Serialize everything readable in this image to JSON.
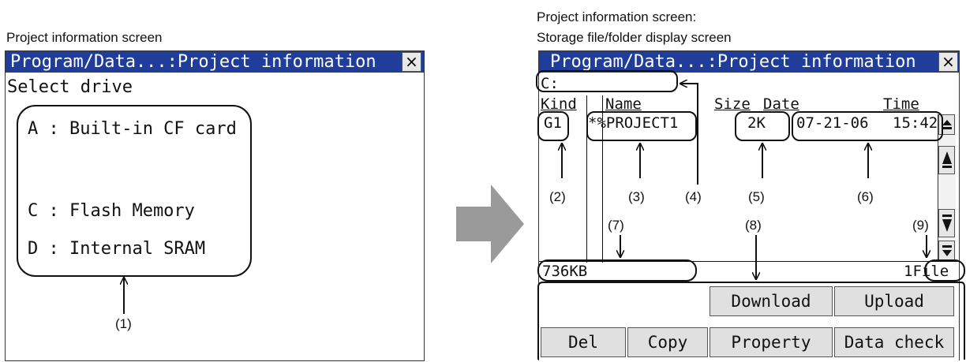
{
  "left_caption": "Project information screen",
  "right_caption_line1": "Project information screen:",
  "right_caption_line2": "Storage file/folder display screen",
  "left_screen": {
    "title": "Program/Data...:Project information",
    "close_glyph": "×",
    "prompt": "Select drive",
    "drives": [
      {
        "label": "A : Built-in CF card"
      },
      {
        "label": "C : Flash Memory"
      },
      {
        "label": "D : Internal SRAM"
      }
    ],
    "callout": "(1)"
  },
  "right_screen": {
    "title": "Program/Data...:Project information",
    "close_glyph": "×",
    "path": "C:",
    "headers": {
      "kind": "Kind",
      "name": "Name",
      "size": "Size",
      "date": "Date",
      "time": "Time"
    },
    "row": {
      "kind": "G1",
      "name": "*%PROJECT1",
      "size": "2K",
      "date": "07-21-06",
      "time": "15:42"
    },
    "free_space": "736KB",
    "file_count": "1File",
    "callouts": [
      "(2)",
      "(3)",
      "(4)",
      "(5)",
      "(6)",
      "(7)",
      "(8)",
      "(9)"
    ],
    "buttons": {
      "download": "Download",
      "upload": "Upload",
      "del": "Del",
      "copy": "Copy",
      "property": "Property",
      "data_check": "Data check"
    },
    "scroll_icons": [
      "scroll-top-icon",
      "scroll-up-icon",
      "scroll-down-icon",
      "scroll-bottom-icon"
    ]
  },
  "transition_arrow_color": "#9a9a9a",
  "titlebar_color": "#1f3d99"
}
